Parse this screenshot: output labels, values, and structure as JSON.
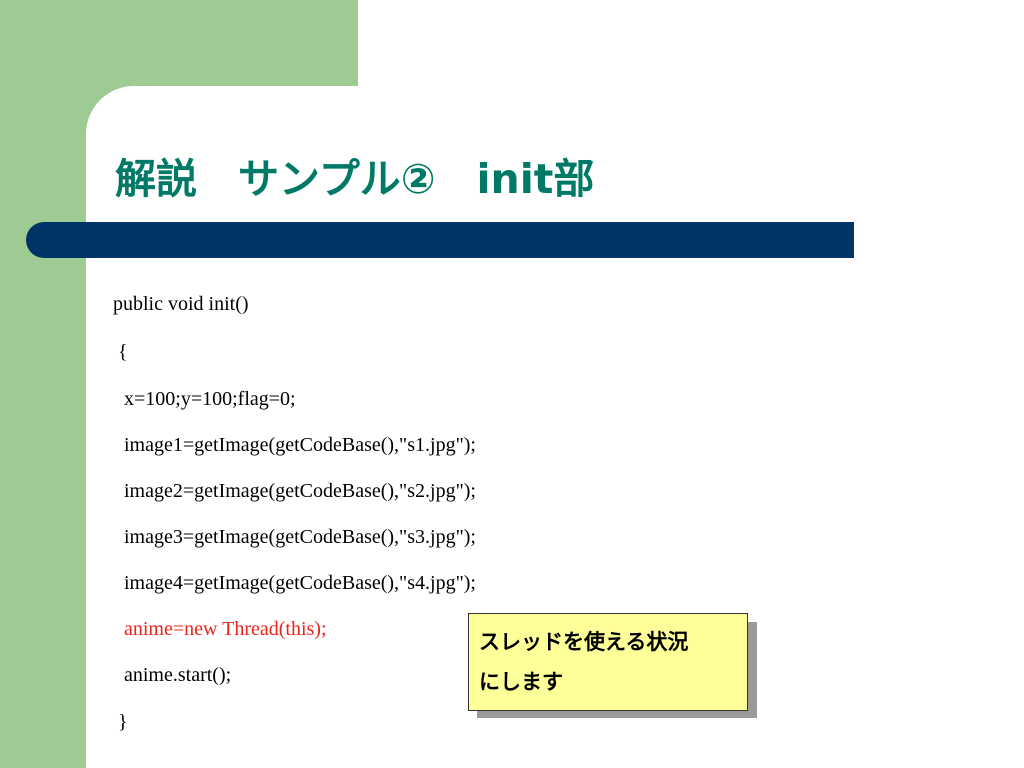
{
  "slide": {
    "title": "解説　サンプル②　init部",
    "code_lines": [
      "public void init()",
      "{",
      "x=100;y=100;flag=0;",
      "image1=getImage(getCodeBase(),\"s1.jpg\");",
      "image2=getImage(getCodeBase(),\"s2.jpg\");",
      "image3=getImage(getCodeBase(),\"s3.jpg\");",
      "image4=getImage(getCodeBase(),\"s4.jpg\");",
      "anime=new Thread(this);",
      "anime.start();",
      "}"
    ],
    "callout": {
      "line1": "スレッドを使える状況",
      "line2": "にします"
    }
  },
  "colors": {
    "sidebar_green": "#9dcb93",
    "title_teal": "#007a66",
    "title_bar_navy": "#003366",
    "highlight_red": "#e8241c",
    "callout_yellow": "#ffff99"
  }
}
